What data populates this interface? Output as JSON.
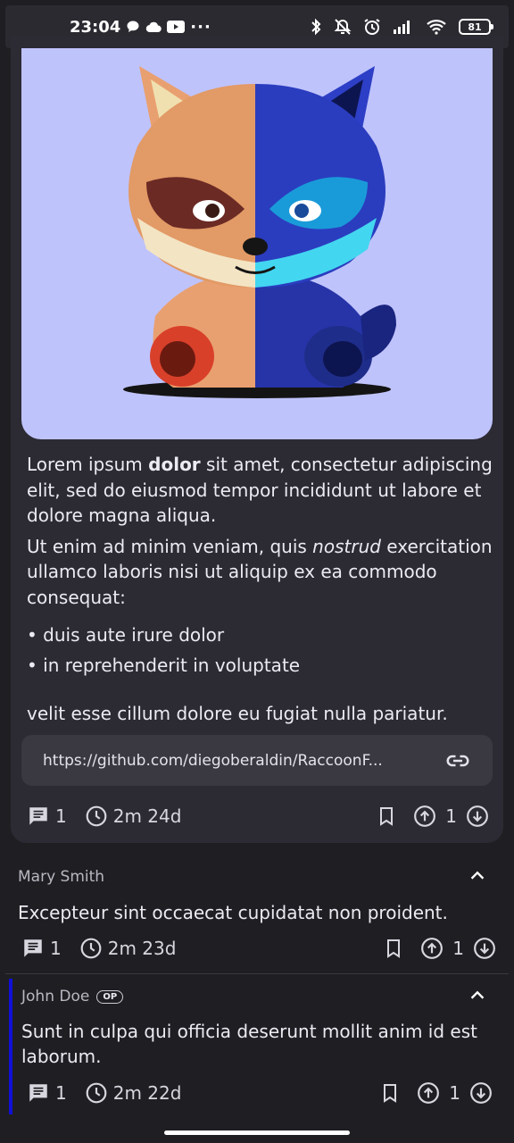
{
  "status_bar": {
    "time": "23:04",
    "battery": "81",
    "more": "···"
  },
  "post": {
    "image_alt": "raccoon illustration",
    "paragraph1_pre": "Lorem ipsum ",
    "paragraph1_bold": "dolor",
    "paragraph1_post": " sit amet, consectetur adipiscing elit, sed do eiusmod tempor incididunt ut labore et dolore magna aliqua.",
    "paragraph2_pre": "Ut enim ad minim veniam, quis ",
    "paragraph2_italic": "nostrud",
    "paragraph2_post": " exercitation ullamco laboris nisi ut aliquip ex ea commodo consequat:",
    "bullets": [
      "• duis aute irure dolor",
      "• in reprehenderit in voluptate"
    ],
    "paragraph3": "velit esse cillum dolore eu fugiat nulla pariatur.",
    "link": "https://github.com/diegoberaldin/RaccoonF...",
    "comments_count": "1",
    "age": "2m 24d",
    "score": "1"
  },
  "comments": [
    {
      "author": "Mary Smith",
      "text": "Excepteur sint occaecat cupidatat non proident.",
      "replies": "1",
      "age": "2m 23d",
      "score": "1"
    },
    {
      "author": "John Doe",
      "badge": "OP",
      "text": "Sunt in culpa qui officia deserunt mollit anim id est laborum.",
      "replies": "1",
      "age": "2m 22d",
      "score": "1"
    }
  ],
  "colors": {
    "background": "#1f1f23",
    "card": "#2c2b34",
    "image_bg": "#bfc3fb",
    "thread_bar": "#1010d8"
  }
}
